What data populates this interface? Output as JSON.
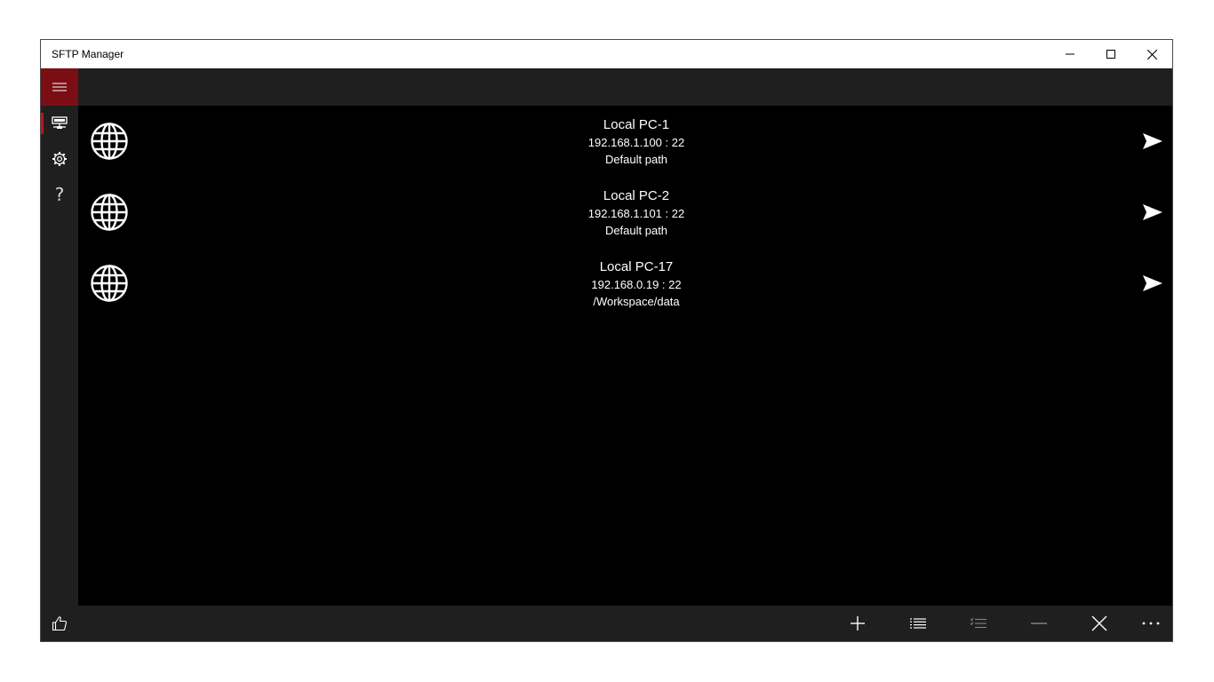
{
  "window": {
    "title": "SFTP Manager"
  },
  "nav": {
    "items": [
      {
        "icon": "server-icon",
        "active": true
      },
      {
        "icon": "gear-icon",
        "active": false
      },
      {
        "icon": "help-icon",
        "glyph": "?",
        "active": false
      }
    ],
    "footer_icon": "thumbs-up-icon"
  },
  "connections": [
    {
      "name": "Local PC-1",
      "address": "192.168.1.100 : 22",
      "path": "Default path"
    },
    {
      "name": "Local PC-2",
      "address": "192.168.1.101 : 22",
      "path": "Default path"
    },
    {
      "name": "Local PC-17",
      "address": "192.168.0.19 : 22",
      "path": "/Workspace/data"
    }
  ],
  "commandbar": {
    "buttons": [
      {
        "icon": "add-icon",
        "enabled": true
      },
      {
        "icon": "list-icon",
        "enabled": true
      },
      {
        "icon": "checklist-icon",
        "enabled": false
      },
      {
        "icon": "remove-icon",
        "enabled": false
      },
      {
        "icon": "close-icon",
        "enabled": true
      },
      {
        "icon": "more-icon",
        "enabled": true
      }
    ]
  },
  "colors": {
    "accent": "#7b0e14",
    "active_indicator": "#c1121c",
    "chrome": "#1f1f1f",
    "content_bg": "#000000",
    "text": "#ffffff"
  }
}
